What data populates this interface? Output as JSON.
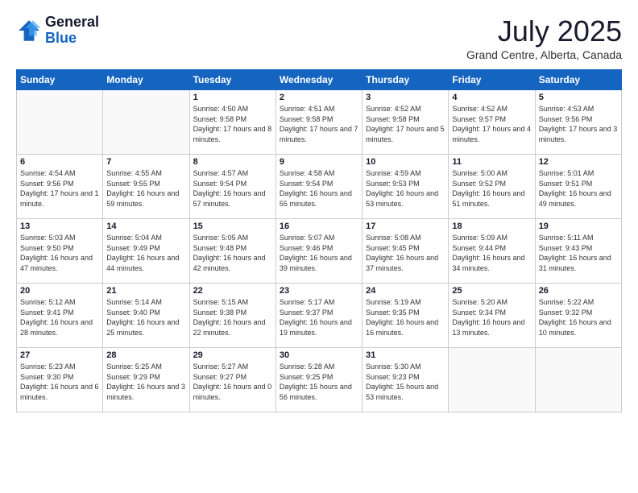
{
  "header": {
    "logo_general": "General",
    "logo_blue": "Blue",
    "month_title": "July 2025",
    "location": "Grand Centre, Alberta, Canada"
  },
  "days_of_week": [
    "Sunday",
    "Monday",
    "Tuesday",
    "Wednesday",
    "Thursday",
    "Friday",
    "Saturday"
  ],
  "weeks": [
    [
      {
        "day": "",
        "info": ""
      },
      {
        "day": "",
        "info": ""
      },
      {
        "day": "1",
        "info": "Sunrise: 4:50 AM\nSunset: 9:58 PM\nDaylight: 17 hours\nand 8 minutes."
      },
      {
        "day": "2",
        "info": "Sunrise: 4:51 AM\nSunset: 9:58 PM\nDaylight: 17 hours\nand 7 minutes."
      },
      {
        "day": "3",
        "info": "Sunrise: 4:52 AM\nSunset: 9:58 PM\nDaylight: 17 hours\nand 5 minutes."
      },
      {
        "day": "4",
        "info": "Sunrise: 4:52 AM\nSunset: 9:57 PM\nDaylight: 17 hours\nand 4 minutes."
      },
      {
        "day": "5",
        "info": "Sunrise: 4:53 AM\nSunset: 9:56 PM\nDaylight: 17 hours\nand 3 minutes."
      }
    ],
    [
      {
        "day": "6",
        "info": "Sunrise: 4:54 AM\nSunset: 9:56 PM\nDaylight: 17 hours\nand 1 minute."
      },
      {
        "day": "7",
        "info": "Sunrise: 4:55 AM\nSunset: 9:55 PM\nDaylight: 16 hours\nand 59 minutes."
      },
      {
        "day": "8",
        "info": "Sunrise: 4:57 AM\nSunset: 9:54 PM\nDaylight: 16 hours\nand 57 minutes."
      },
      {
        "day": "9",
        "info": "Sunrise: 4:58 AM\nSunset: 9:54 PM\nDaylight: 16 hours\nand 55 minutes."
      },
      {
        "day": "10",
        "info": "Sunrise: 4:59 AM\nSunset: 9:53 PM\nDaylight: 16 hours\nand 53 minutes."
      },
      {
        "day": "11",
        "info": "Sunrise: 5:00 AM\nSunset: 9:52 PM\nDaylight: 16 hours\nand 51 minutes."
      },
      {
        "day": "12",
        "info": "Sunrise: 5:01 AM\nSunset: 9:51 PM\nDaylight: 16 hours\nand 49 minutes."
      }
    ],
    [
      {
        "day": "13",
        "info": "Sunrise: 5:03 AM\nSunset: 9:50 PM\nDaylight: 16 hours\nand 47 minutes."
      },
      {
        "day": "14",
        "info": "Sunrise: 5:04 AM\nSunset: 9:49 PM\nDaylight: 16 hours\nand 44 minutes."
      },
      {
        "day": "15",
        "info": "Sunrise: 5:05 AM\nSunset: 9:48 PM\nDaylight: 16 hours\nand 42 minutes."
      },
      {
        "day": "16",
        "info": "Sunrise: 5:07 AM\nSunset: 9:46 PM\nDaylight: 16 hours\nand 39 minutes."
      },
      {
        "day": "17",
        "info": "Sunrise: 5:08 AM\nSunset: 9:45 PM\nDaylight: 16 hours\nand 37 minutes."
      },
      {
        "day": "18",
        "info": "Sunrise: 5:09 AM\nSunset: 9:44 PM\nDaylight: 16 hours\nand 34 minutes."
      },
      {
        "day": "19",
        "info": "Sunrise: 5:11 AM\nSunset: 9:43 PM\nDaylight: 16 hours\nand 31 minutes."
      }
    ],
    [
      {
        "day": "20",
        "info": "Sunrise: 5:12 AM\nSunset: 9:41 PM\nDaylight: 16 hours\nand 28 minutes."
      },
      {
        "day": "21",
        "info": "Sunrise: 5:14 AM\nSunset: 9:40 PM\nDaylight: 16 hours\nand 25 minutes."
      },
      {
        "day": "22",
        "info": "Sunrise: 5:15 AM\nSunset: 9:38 PM\nDaylight: 16 hours\nand 22 minutes."
      },
      {
        "day": "23",
        "info": "Sunrise: 5:17 AM\nSunset: 9:37 PM\nDaylight: 16 hours\nand 19 minutes."
      },
      {
        "day": "24",
        "info": "Sunrise: 5:19 AM\nSunset: 9:35 PM\nDaylight: 16 hours\nand 16 minutes."
      },
      {
        "day": "25",
        "info": "Sunrise: 5:20 AM\nSunset: 9:34 PM\nDaylight: 16 hours\nand 13 minutes."
      },
      {
        "day": "26",
        "info": "Sunrise: 5:22 AM\nSunset: 9:32 PM\nDaylight: 16 hours\nand 10 minutes."
      }
    ],
    [
      {
        "day": "27",
        "info": "Sunrise: 5:23 AM\nSunset: 9:30 PM\nDaylight: 16 hours\nand 6 minutes."
      },
      {
        "day": "28",
        "info": "Sunrise: 5:25 AM\nSunset: 9:29 PM\nDaylight: 16 hours\nand 3 minutes."
      },
      {
        "day": "29",
        "info": "Sunrise: 5:27 AM\nSunset: 9:27 PM\nDaylight: 16 hours\nand 0 minutes."
      },
      {
        "day": "30",
        "info": "Sunrise: 5:28 AM\nSunset: 9:25 PM\nDaylight: 15 hours\nand 56 minutes."
      },
      {
        "day": "31",
        "info": "Sunrise: 5:30 AM\nSunset: 9:23 PM\nDaylight: 15 hours\nand 53 minutes."
      },
      {
        "day": "",
        "info": ""
      },
      {
        "day": "",
        "info": ""
      }
    ]
  ]
}
